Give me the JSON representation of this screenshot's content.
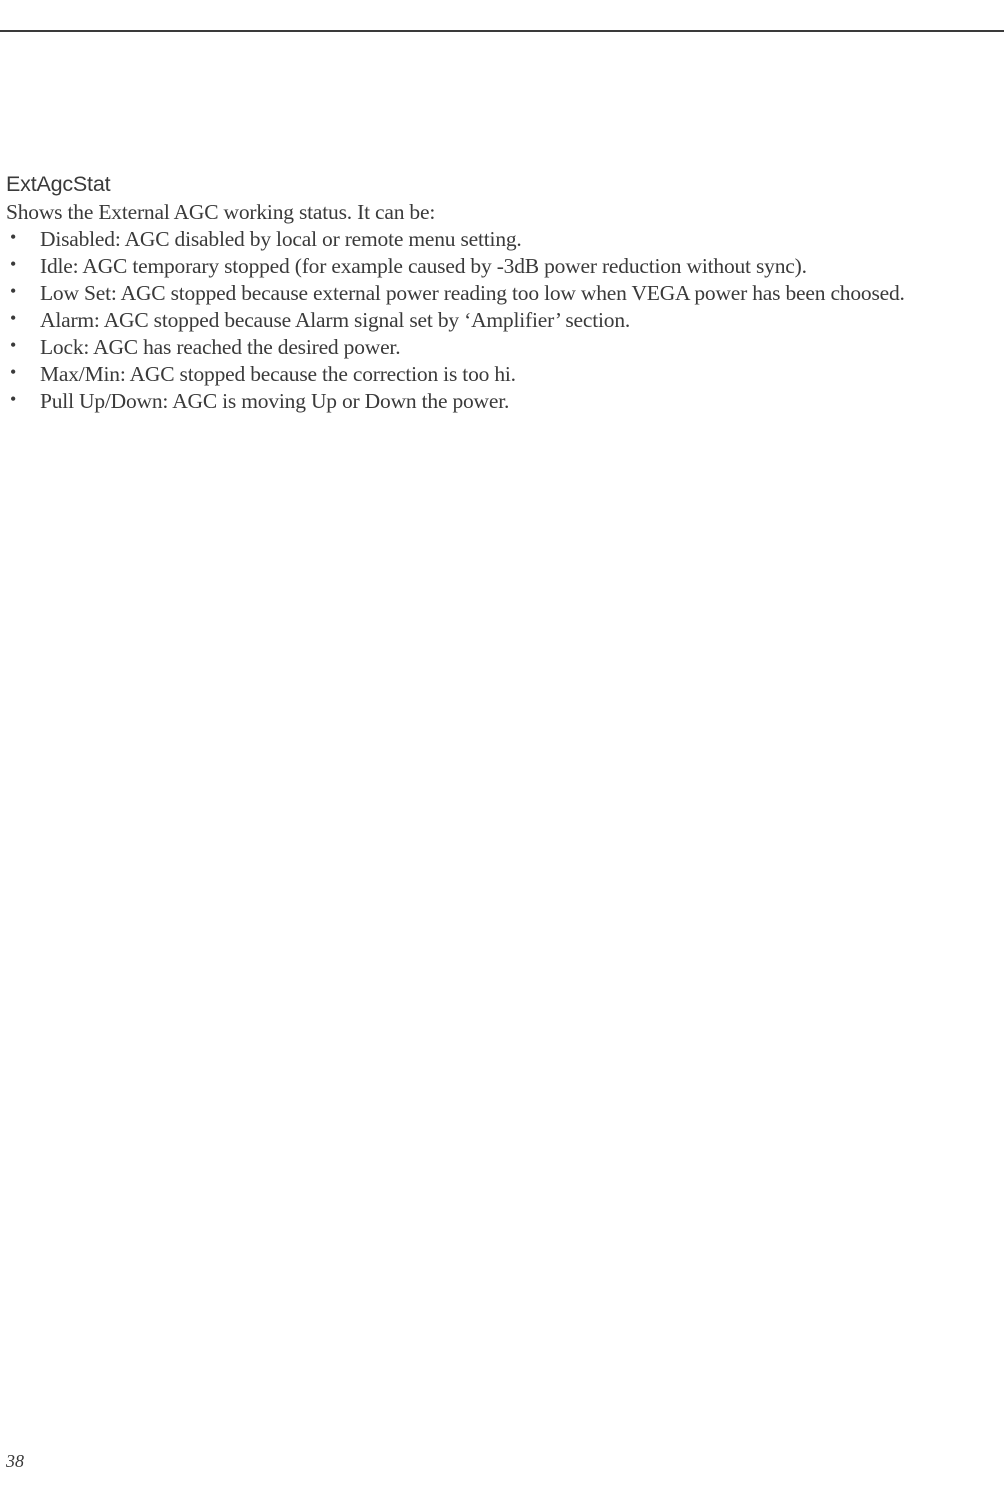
{
  "section": {
    "title": "ExtAgcStat",
    "intro": "Shows the External AGC working status. It can be:",
    "bullets": [
      "Disabled: AGC disabled by local or remote menu setting.",
      "Idle: AGC temporary stopped (for example caused by -3dB power reduction without sync).",
      "Low Set: AGC stopped because external power reading too low when VEGA power has been choosed.",
      "Alarm: AGC stopped because Alarm signal set by ‘Amplifier’ section.",
      "Lock: AGC has reached the desired power.",
      "Max/Min: AGC stopped because the correction is too hi.",
      "Pull Up/Down: AGC is moving Up or Down the power."
    ]
  },
  "page_number": "38"
}
